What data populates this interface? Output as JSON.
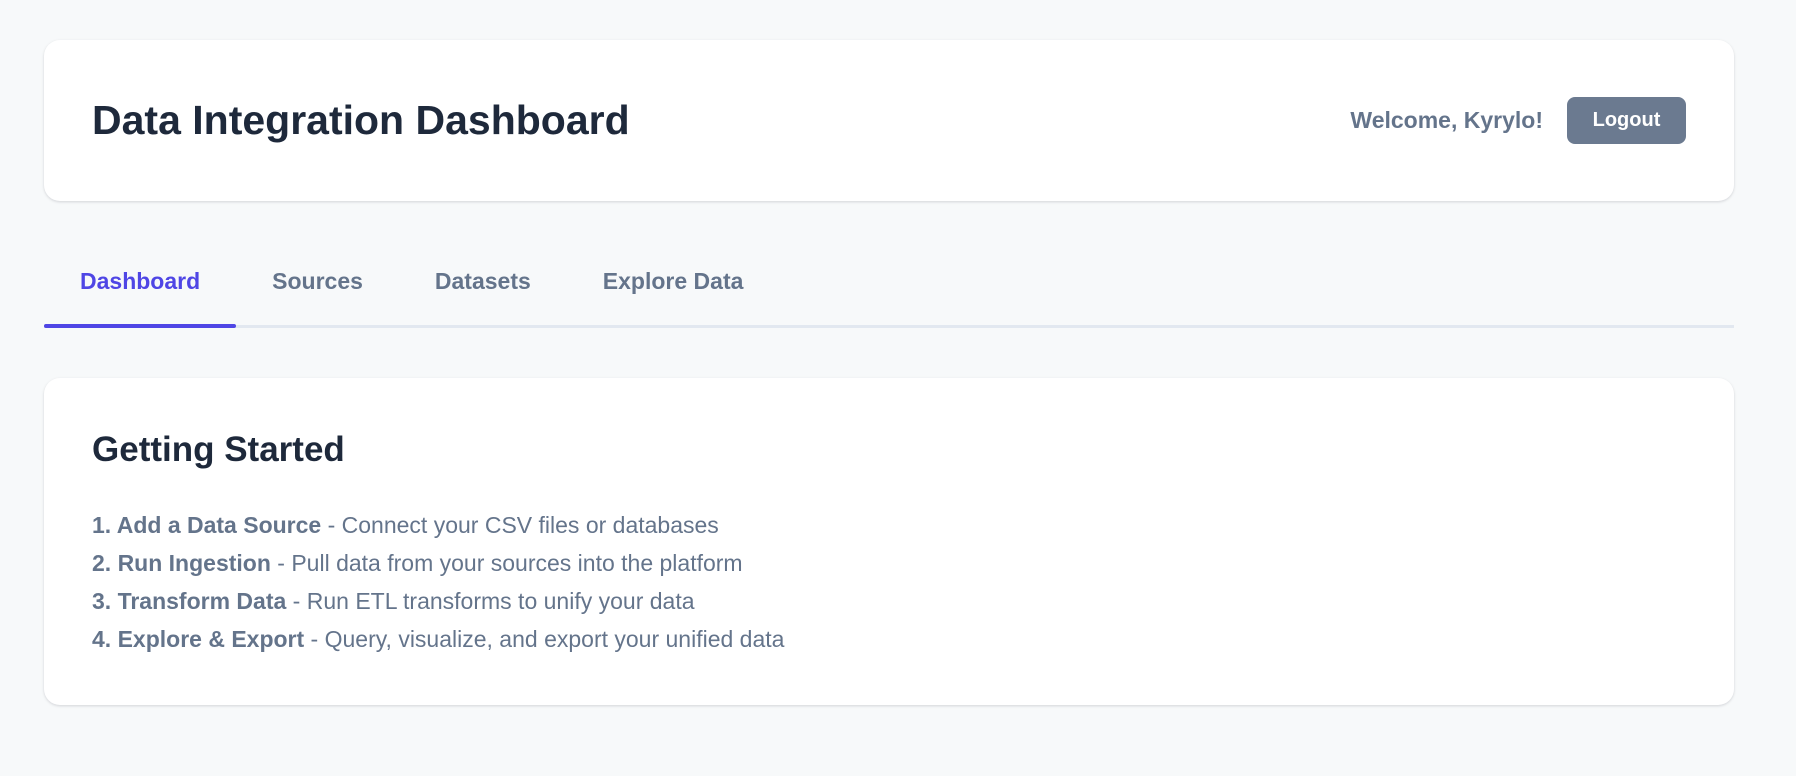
{
  "header": {
    "title": "Data Integration Dashboard",
    "welcome": "Welcome, Kyrylo!",
    "logout_label": "Logout"
  },
  "tabs": [
    {
      "label": "Dashboard",
      "active": true
    },
    {
      "label": "Sources",
      "active": false
    },
    {
      "label": "Datasets",
      "active": false
    },
    {
      "label": "Explore Data",
      "active": false
    }
  ],
  "getting_started": {
    "title": "Getting Started",
    "steps": [
      {
        "title": "1. Add a Data Source",
        "description": " - Connect your CSV files or databases"
      },
      {
        "title": "2. Run Ingestion",
        "description": " - Pull data from your sources into the platform"
      },
      {
        "title": "3. Transform Data",
        "description": " - Run ETL transforms to unify your data"
      },
      {
        "title": "4. Explore & Export",
        "description": " - Query, visualize, and export your unified data"
      }
    ]
  },
  "colors": {
    "accent": "#4f46e5",
    "button": "#6b7a90",
    "muted_text": "#64748b",
    "heading_text": "#1e293b",
    "background": "#f7f9fa"
  }
}
